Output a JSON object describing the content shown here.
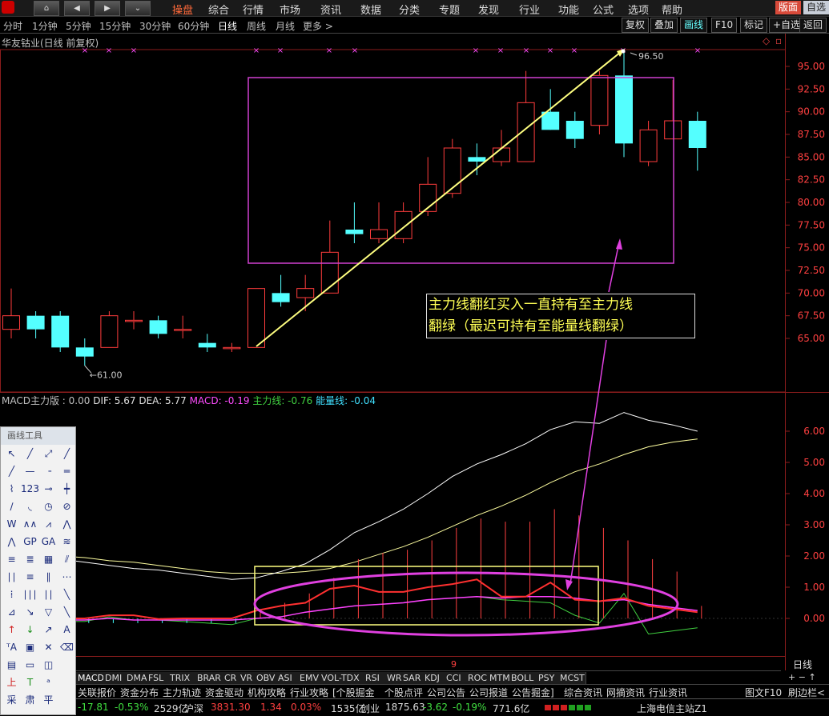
{
  "menu": {
    "items": [
      "操盘",
      "综合",
      "行情",
      "市场",
      "资讯",
      "数据",
      "分类",
      "专题",
      "发现",
      "行业",
      "功能",
      "公式",
      "选项",
      "帮助"
    ],
    "active_index": 0,
    "right_buttons": [
      "版面",
      "自选"
    ]
  },
  "periods": {
    "items": [
      "分时",
      "1分钟",
      "5分钟",
      "15分钟",
      "30分钟",
      "60分钟",
      "日线",
      "周线",
      "月线",
      "更多 >"
    ],
    "active_index": 6
  },
  "toolbar": {
    "items": [
      "复权",
      "叠加",
      "画线",
      "F10",
      "标记",
      "+自选",
      "返回"
    ],
    "active_index": 2
  },
  "stock_title": "华友钴业(日线 前复权)",
  "price_axis": [
    "95.00",
    "92.50",
    "90.00",
    "87.50",
    "85.00",
    "82.50",
    "80.00",
    "77.50",
    "75.00",
    "72.50",
    "70.00",
    "67.50",
    "65.00"
  ],
  "high_label": "96.50",
  "low_label": "61.00",
  "candles": [
    [
      66.0,
      70.5,
      65.0,
      67.5
    ],
    [
      67.5,
      68.0,
      65.0,
      66.0
    ],
    [
      67.5,
      68.0,
      63.5,
      64.0
    ],
    [
      64.0,
      65.0,
      62.0,
      63.0
    ],
    [
      64.0,
      68.0,
      64.0,
      67.5
    ],
    [
      67.0,
      68.0,
      66.0,
      67.0
    ],
    [
      67.0,
      67.5,
      65.0,
      65.5
    ],
    [
      66.0,
      67.5,
      65.0,
      66.0
    ],
    [
      64.5,
      65.5,
      63.5,
      64.0
    ],
    [
      64.0,
      64.5,
      63.5,
      64.0
    ],
    [
      64.0,
      70.5,
      64.0,
      70.5
    ],
    [
      70.0,
      72.0,
      68.5,
      69.0
    ],
    [
      69.5,
      72.0,
      68.0,
      70.5
    ],
    [
      70.0,
      78.0,
      70.0,
      74.5
    ],
    [
      77.0,
      80.0,
      75.5,
      76.5
    ],
    [
      76.0,
      80.0,
      75.5,
      77.0
    ],
    [
      76.0,
      80.0,
      75.5,
      79.0
    ],
    [
      79.0,
      85.0,
      78.5,
      82.0
    ],
    [
      81.0,
      87.0,
      80.5,
      86.0
    ],
    [
      85.0,
      86.5,
      83.0,
      84.5
    ],
    [
      84.5,
      88.0,
      84.0,
      86.0
    ],
    [
      84.5,
      94.5,
      84.5,
      91.0
    ],
    [
      90.0,
      92.5,
      88.0,
      88.0
    ],
    [
      89.0,
      90.0,
      86.0,
      87.0
    ],
    [
      88.5,
      94.5,
      87.5,
      94.0
    ],
    [
      94.0,
      96.5,
      85.0,
      86.5
    ],
    [
      84.5,
      89.0,
      84.0,
      88.0
    ],
    [
      87.0,
      93.5,
      87.0,
      89.0
    ],
    [
      89.0,
      90.0,
      83.5,
      86.0
    ]
  ],
  "macd_header": {
    "name": "MACD主力版 : 0.00",
    "dif": "DIF: 5.67",
    "dea": "DEA: 5.77",
    "macd": "MACD: -0.19",
    "main": "主力线: -0.76",
    "energy": "能量线: -0.04"
  },
  "macd_axis": [
    "6.00",
    "5.00",
    "4.00",
    "3.00",
    "2.00",
    "1.00",
    "0.00"
  ],
  "annotation_lines": [
    "主力线翻红买入一直持有至主力线",
    "翻绿（最迟可持有至能量线翻绿）"
  ],
  "draw_tools": {
    "header": "画线工具",
    "icons": [
      "↖",
      "╱",
      "⤢",
      "╱",
      "╱",
      "—",
      "╶",
      "═",
      "⌇",
      "123",
      "⊸",
      "┿",
      "∕",
      "◟",
      "◷",
      "⊘",
      "W",
      "∧∧",
      "⩘",
      "⋀",
      "⋀",
      "GP",
      "GA",
      "≋",
      "≡",
      "≣",
      "▦",
      "⫽",
      "∣∣",
      "≡",
      "∥",
      "⋯",
      "⁞",
      "∣∣∣",
      "∣∣",
      "╲",
      "⊿",
      "↘",
      "▽",
      "╲",
      "↑",
      "↓",
      "↗",
      "A",
      "ᵀA",
      "▣",
      "✕",
      "⌫",
      "▤",
      "▭",
      "◫",
      "",
      "上",
      "T",
      "ᵃ",
      "",
      "采",
      "肃",
      "平",
      ""
    ]
  },
  "indicator_tabs": [
    "MACD",
    "DMI",
    "DMA",
    "FSL",
    "TRIX",
    "BRAR",
    "CR",
    "VR",
    "OBV",
    "ASI",
    "EMV",
    "VOL-TDX",
    "RSI",
    "WR",
    "SAR",
    "KDJ",
    "CCI",
    "ROC",
    "MTM",
    "BOLL",
    "PSY",
    "MCST"
  ],
  "scroll_marker": "9",
  "period_label": "日线",
  "info_tabs": [
    "关联报价",
    "资金分布",
    "主力轨迹",
    "资金驱动",
    "机构攻略",
    "行业攻略",
    "[个股掘金",
    "个股点评",
    "公司公告",
    "公司报道",
    "公告掘金]",
    "综合资讯",
    "网摘资讯",
    "行业资讯"
  ],
  "info_tabs_right": [
    "图文F10",
    "刷边栏<"
  ],
  "status": {
    "items": [
      "-17.81",
      "-0.53%",
      "2529亿",
      "沪深",
      "3831.30",
      "1.34",
      "0.03%",
      "1535亿",
      "创业",
      "1875.63",
      "-3.62",
      "-0.19%",
      "771.6亿"
    ],
    "server": "上海电信主站Z1"
  },
  "colors": {
    "up": "#ff3c3c",
    "down": "#54ffff",
    "bg": "#000000"
  }
}
